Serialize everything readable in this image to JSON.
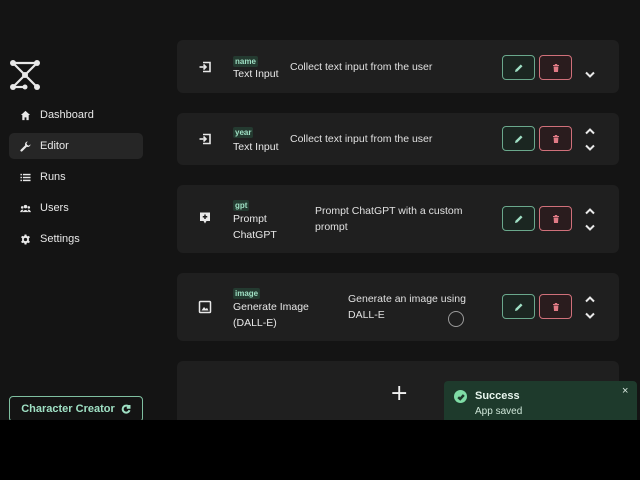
{
  "colors": {
    "background": "#141414",
    "card": "#1f1f1f",
    "accent": "#9fe0c4",
    "danger": "#d0707a",
    "toast_bg": "#1e3a2c"
  },
  "sidebar": {
    "logo_icon": "node-graph-logo-icon",
    "items": [
      {
        "label": "Dashboard",
        "icon": "home-icon",
        "active": false
      },
      {
        "label": "Editor",
        "icon": "wrench-icon",
        "active": true
      },
      {
        "label": "Runs",
        "icon": "list-icon",
        "active": false
      },
      {
        "label": "Users",
        "icon": "users-icon",
        "active": false
      },
      {
        "label": "Settings",
        "icon": "gear-icon",
        "active": false
      }
    ],
    "app_switcher": {
      "label": "Character Creator",
      "icon": "refresh-icon"
    }
  },
  "steps": [
    {
      "tag": "name",
      "title": "Text Input",
      "description": "Collect text input from the user",
      "icon": "input-icon"
    },
    {
      "tag": "year",
      "title": "Text Input",
      "description": "Collect text input from the user",
      "icon": "input-icon"
    },
    {
      "tag": "gpt",
      "title_line1": "Prompt",
      "title_line2": "ChatGPT",
      "description_line1": "Prompt ChatGPT with a custom",
      "description_line2": "prompt",
      "icon": "chat-plus-icon"
    },
    {
      "tag": "image",
      "title_line1": "Generate Image",
      "title_line2": "(DALL-E)",
      "description_line1": "Generate an image using",
      "description_line2": "DALL-E",
      "icon": "image-icon"
    }
  ],
  "add_step": {
    "label": "+"
  },
  "toast": {
    "title": "Success",
    "message": "App saved",
    "close": "×",
    "icon": "check-circle-icon"
  }
}
